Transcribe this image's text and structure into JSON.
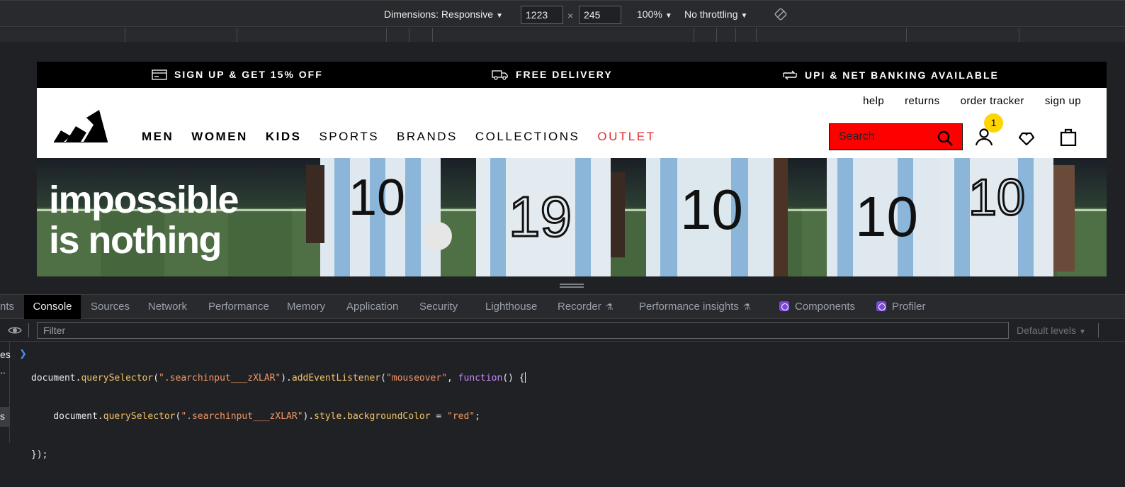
{
  "device_toolbar": {
    "dimensions_label": "Dimensions: Responsive",
    "width": "1223",
    "height": "245",
    "times": "×",
    "zoom": "100%",
    "throttling": "No throttling"
  },
  "site": {
    "promos": [
      {
        "text": "SIGN UP & GET 15% OFF",
        "icon": "card-icon"
      },
      {
        "text": "FREE DELIVERY",
        "icon": "truck-icon"
      },
      {
        "text": "UPI & NET BANKING AVAILABLE",
        "icon": "exchange-icon"
      }
    ],
    "util_links": [
      "help",
      "returns",
      "order tracker",
      "sign up"
    ],
    "nav": [
      {
        "label": "MEN",
        "style": "bold"
      },
      {
        "label": "WOMEN",
        "style": "bold"
      },
      {
        "label": "KIDS",
        "style": "bold"
      },
      {
        "label": "SPORTS",
        "style": "regular"
      },
      {
        "label": "BRANDS",
        "style": "regular"
      },
      {
        "label": "COLLECTIONS",
        "style": "regular"
      },
      {
        "label": "OUTLET",
        "style": "outlet"
      }
    ],
    "search_placeholder": "Search",
    "cart_badge": "1",
    "hero": {
      "line1": "impossible",
      "line2": "is nothing",
      "jersey_numbers": [
        "10",
        "19",
        "10",
        "10",
        "10"
      ]
    },
    "colors": {
      "search_bg": "#ff0000",
      "outlet": "#e32b2b",
      "badge": "#ffd500"
    }
  },
  "devtools": {
    "tabs": [
      {
        "label": "nts",
        "active": false
      },
      {
        "label": "Console",
        "active": true
      },
      {
        "label": "Sources",
        "active": false
      },
      {
        "label": "Network",
        "active": false
      },
      {
        "label": "Performance",
        "active": false
      },
      {
        "label": "Memory",
        "active": false
      },
      {
        "label": "Application",
        "active": false
      },
      {
        "label": "Security",
        "active": false
      },
      {
        "label": "Lighthouse",
        "active": false
      },
      {
        "label": "Recorder",
        "active": false
      },
      {
        "label": "Performance insights",
        "active": false
      },
      {
        "label": "Components",
        "active": false
      },
      {
        "label": "Profiler",
        "active": false
      }
    ],
    "filter_placeholder": "Filter",
    "levels": "Default levels",
    "sidebar_fragments": [
      "es",
      "..",
      "s"
    ],
    "code_lines": [
      "document.querySelector(\".searchinput___zXLAR\").addEventListener(\"mouseover\", function() {",
      "    document.querySelector(\".searchinput___zXLAR\").style.backgroundColor = \"red\";",
      "});"
    ]
  }
}
